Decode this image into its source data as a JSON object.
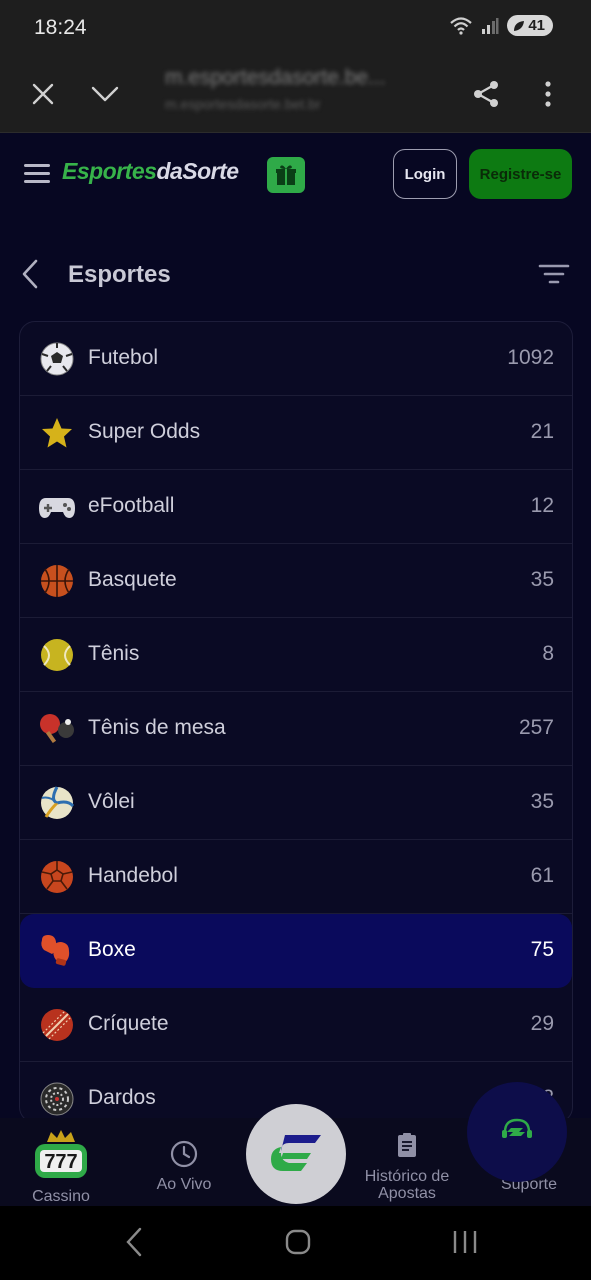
{
  "status_bar": {
    "time": "18:24",
    "battery": "41"
  },
  "browser": {
    "url_main": "m.esportesdasorte.be...",
    "url_sub": "m.esportesdasorte.bet.br"
  },
  "header": {
    "logo_part1": "Esportes",
    "logo_part2": "daSorte",
    "login_label": "Login",
    "register_label": "Registre-se"
  },
  "section": {
    "title": "Esportes"
  },
  "sports": [
    {
      "name": "Futebol",
      "count": "1092",
      "icon": "soccer-ball-icon"
    },
    {
      "name": "Super Odds",
      "count": "21",
      "icon": "star-icon"
    },
    {
      "name": "eFootball",
      "count": "12",
      "icon": "gamepad-icon"
    },
    {
      "name": "Basquete",
      "count": "35",
      "icon": "basketball-icon"
    },
    {
      "name": "Tênis",
      "count": "8",
      "icon": "tennis-ball-icon"
    },
    {
      "name": "Tênis de mesa",
      "count": "257",
      "icon": "table-tennis-icon"
    },
    {
      "name": "Vôlei",
      "count": "35",
      "icon": "volleyball-icon"
    },
    {
      "name": "Handebol",
      "count": "61",
      "icon": "handball-icon"
    },
    {
      "name": "Boxe",
      "count": "75",
      "icon": "boxing-glove-icon",
      "selected": true
    },
    {
      "name": "Críquete",
      "count": "29",
      "icon": "cricket-ball-icon"
    },
    {
      "name": "Dardos",
      "count": "2",
      "icon": "dartboard-icon"
    }
  ],
  "bottom_nav": {
    "casino_label": "Cassino",
    "live_label": "Ao Vivo",
    "history_label_1": "Histórico de",
    "history_label_2": "Apostas",
    "support_label": "Suporte"
  },
  "colors": {
    "brand_green": "#37b34a",
    "selected_row": "#0a0a5c",
    "background": "#070722"
  }
}
